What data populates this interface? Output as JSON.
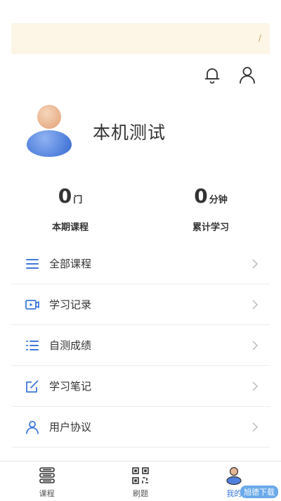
{
  "banner": {
    "mark": "/"
  },
  "header": {
    "bell_icon": "bell-icon",
    "user_icon": "user-icon"
  },
  "profile": {
    "name": "本机测试"
  },
  "stats": [
    {
      "value": "0",
      "unit": "门",
      "label": "本期课程"
    },
    {
      "value": "0",
      "unit": "分钟",
      "label": "累计学习"
    }
  ],
  "menu": [
    {
      "label": "全部课程",
      "icon": "list-icon"
    },
    {
      "label": "学习记录",
      "icon": "video-icon"
    },
    {
      "label": "自测成绩",
      "icon": "bullet-list-icon"
    },
    {
      "label": "学习笔记",
      "icon": "edit-icon"
    },
    {
      "label": "用户协议",
      "icon": "person-icon"
    }
  ],
  "tabs": [
    {
      "label": "课程",
      "icon": "books-icon"
    },
    {
      "label": "刷题",
      "icon": "qrcode-icon"
    },
    {
      "label": "我的",
      "icon": "profile-icon",
      "active": true
    }
  ],
  "watermark": "旭德下载",
  "colors": {
    "accent": "#3f78d8",
    "banner": "#fdf5e6"
  }
}
